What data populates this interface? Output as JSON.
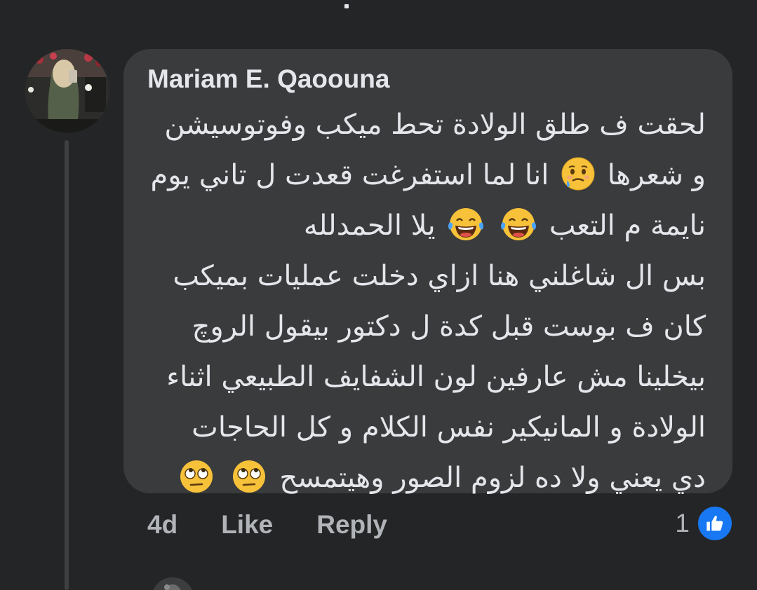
{
  "comment": {
    "author": "Mariam E. Qaoouna",
    "lines": [
      {
        "text": "لحقت ف طلق الولادة تحط ميكب وفوتوسيشن",
        "emojis": []
      },
      {
        "text": "و شعرها",
        "emojis": [
          "crying-face"
        ],
        "text_after": "انا لما استفرغت قعدت ل تاني يوم"
      },
      {
        "text": "نايمة م التعب",
        "emojis": [
          "tears-of-joy",
          "tears-of-joy"
        ],
        "text_after": "يلا الحمدلله"
      },
      {
        "text": "بس ال شاغلني هنا ازاي دخلت عمليات بميكب",
        "emojis": []
      },
      {
        "text": "كان ف بوست قبل كدة ل دكتور بيقول الروچ",
        "emojis": []
      },
      {
        "text": "بيخلينا مش عارفين لون الشفايف الطبيعي اثناء",
        "emojis": []
      },
      {
        "text": "الولادة و المانيكير نفس الكلام و كل الحاجات",
        "emojis": []
      },
      {
        "text": "دي يعني ولا ده لزوم الصور وهيتمسح",
        "emojis": [
          "eye-roll",
          "eye-roll"
        ]
      }
    ],
    "time": "4d",
    "like_label": "Like",
    "reply_label": "Reply",
    "reaction_count": "1",
    "reaction_type": "like-icon"
  },
  "colors": {
    "background": "#242526",
    "bubble": "#3a3b3c",
    "text_primary": "#e4e6eb",
    "text_secondary": "#b0b3b8",
    "like_blue": "#1877f2"
  }
}
